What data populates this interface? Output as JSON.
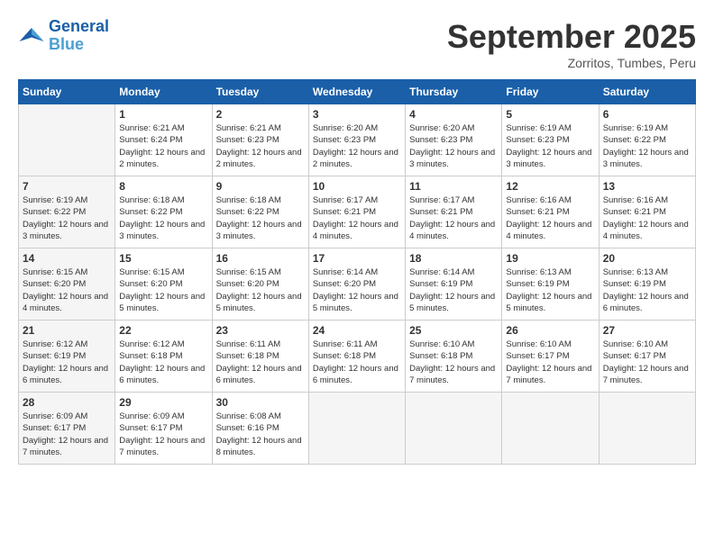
{
  "logo": {
    "line1": "General",
    "line2": "Blue"
  },
  "title": "September 2025",
  "subtitle": "Zorritos, Tumbes, Peru",
  "days_of_week": [
    "Sunday",
    "Monday",
    "Tuesday",
    "Wednesday",
    "Thursday",
    "Friday",
    "Saturday"
  ],
  "weeks": [
    [
      {
        "day": "",
        "sunrise": "",
        "sunset": "",
        "daylight": "",
        "empty": true
      },
      {
        "day": "1",
        "sunrise": "Sunrise: 6:21 AM",
        "sunset": "Sunset: 6:24 PM",
        "daylight": "Daylight: 12 hours and 2 minutes."
      },
      {
        "day": "2",
        "sunrise": "Sunrise: 6:21 AM",
        "sunset": "Sunset: 6:23 PM",
        "daylight": "Daylight: 12 hours and 2 minutes."
      },
      {
        "day": "3",
        "sunrise": "Sunrise: 6:20 AM",
        "sunset": "Sunset: 6:23 PM",
        "daylight": "Daylight: 12 hours and 2 minutes."
      },
      {
        "day": "4",
        "sunrise": "Sunrise: 6:20 AM",
        "sunset": "Sunset: 6:23 PM",
        "daylight": "Daylight: 12 hours and 3 minutes."
      },
      {
        "day": "5",
        "sunrise": "Sunrise: 6:19 AM",
        "sunset": "Sunset: 6:23 PM",
        "daylight": "Daylight: 12 hours and 3 minutes."
      },
      {
        "day": "6",
        "sunrise": "Sunrise: 6:19 AM",
        "sunset": "Sunset: 6:22 PM",
        "daylight": "Daylight: 12 hours and 3 minutes."
      }
    ],
    [
      {
        "day": "7",
        "sunrise": "Sunrise: 6:19 AM",
        "sunset": "Sunset: 6:22 PM",
        "daylight": "Daylight: 12 hours and 3 minutes."
      },
      {
        "day": "8",
        "sunrise": "Sunrise: 6:18 AM",
        "sunset": "Sunset: 6:22 PM",
        "daylight": "Daylight: 12 hours and 3 minutes."
      },
      {
        "day": "9",
        "sunrise": "Sunrise: 6:18 AM",
        "sunset": "Sunset: 6:22 PM",
        "daylight": "Daylight: 12 hours and 3 minutes."
      },
      {
        "day": "10",
        "sunrise": "Sunrise: 6:17 AM",
        "sunset": "Sunset: 6:21 PM",
        "daylight": "Daylight: 12 hours and 4 minutes."
      },
      {
        "day": "11",
        "sunrise": "Sunrise: 6:17 AM",
        "sunset": "Sunset: 6:21 PM",
        "daylight": "Daylight: 12 hours and 4 minutes."
      },
      {
        "day": "12",
        "sunrise": "Sunrise: 6:16 AM",
        "sunset": "Sunset: 6:21 PM",
        "daylight": "Daylight: 12 hours and 4 minutes."
      },
      {
        "day": "13",
        "sunrise": "Sunrise: 6:16 AM",
        "sunset": "Sunset: 6:21 PM",
        "daylight": "Daylight: 12 hours and 4 minutes."
      }
    ],
    [
      {
        "day": "14",
        "sunrise": "Sunrise: 6:15 AM",
        "sunset": "Sunset: 6:20 PM",
        "daylight": "Daylight: 12 hours and 4 minutes."
      },
      {
        "day": "15",
        "sunrise": "Sunrise: 6:15 AM",
        "sunset": "Sunset: 6:20 PM",
        "daylight": "Daylight: 12 hours and 5 minutes."
      },
      {
        "day": "16",
        "sunrise": "Sunrise: 6:15 AM",
        "sunset": "Sunset: 6:20 PM",
        "daylight": "Daylight: 12 hours and 5 minutes."
      },
      {
        "day": "17",
        "sunrise": "Sunrise: 6:14 AM",
        "sunset": "Sunset: 6:20 PM",
        "daylight": "Daylight: 12 hours and 5 minutes."
      },
      {
        "day": "18",
        "sunrise": "Sunrise: 6:14 AM",
        "sunset": "Sunset: 6:19 PM",
        "daylight": "Daylight: 12 hours and 5 minutes."
      },
      {
        "day": "19",
        "sunrise": "Sunrise: 6:13 AM",
        "sunset": "Sunset: 6:19 PM",
        "daylight": "Daylight: 12 hours and 5 minutes."
      },
      {
        "day": "20",
        "sunrise": "Sunrise: 6:13 AM",
        "sunset": "Sunset: 6:19 PM",
        "daylight": "Daylight: 12 hours and 6 minutes."
      }
    ],
    [
      {
        "day": "21",
        "sunrise": "Sunrise: 6:12 AM",
        "sunset": "Sunset: 6:19 PM",
        "daylight": "Daylight: 12 hours and 6 minutes."
      },
      {
        "day": "22",
        "sunrise": "Sunrise: 6:12 AM",
        "sunset": "Sunset: 6:18 PM",
        "daylight": "Daylight: 12 hours and 6 minutes."
      },
      {
        "day": "23",
        "sunrise": "Sunrise: 6:11 AM",
        "sunset": "Sunset: 6:18 PM",
        "daylight": "Daylight: 12 hours and 6 minutes."
      },
      {
        "day": "24",
        "sunrise": "Sunrise: 6:11 AM",
        "sunset": "Sunset: 6:18 PM",
        "daylight": "Daylight: 12 hours and 6 minutes."
      },
      {
        "day": "25",
        "sunrise": "Sunrise: 6:10 AM",
        "sunset": "Sunset: 6:18 PM",
        "daylight": "Daylight: 12 hours and 7 minutes."
      },
      {
        "day": "26",
        "sunrise": "Sunrise: 6:10 AM",
        "sunset": "Sunset: 6:17 PM",
        "daylight": "Daylight: 12 hours and 7 minutes."
      },
      {
        "day": "27",
        "sunrise": "Sunrise: 6:10 AM",
        "sunset": "Sunset: 6:17 PM",
        "daylight": "Daylight: 12 hours and 7 minutes."
      }
    ],
    [
      {
        "day": "28",
        "sunrise": "Sunrise: 6:09 AM",
        "sunset": "Sunset: 6:17 PM",
        "daylight": "Daylight: 12 hours and 7 minutes."
      },
      {
        "day": "29",
        "sunrise": "Sunrise: 6:09 AM",
        "sunset": "Sunset: 6:17 PM",
        "daylight": "Daylight: 12 hours and 7 minutes."
      },
      {
        "day": "30",
        "sunrise": "Sunrise: 6:08 AM",
        "sunset": "Sunset: 6:16 PM",
        "daylight": "Daylight: 12 hours and 8 minutes."
      },
      {
        "day": "",
        "sunrise": "",
        "sunset": "",
        "daylight": "",
        "empty": true
      },
      {
        "day": "",
        "sunrise": "",
        "sunset": "",
        "daylight": "",
        "empty": true
      },
      {
        "day": "",
        "sunrise": "",
        "sunset": "",
        "daylight": "",
        "empty": true
      },
      {
        "day": "",
        "sunrise": "",
        "sunset": "",
        "daylight": "",
        "empty": true
      }
    ]
  ]
}
